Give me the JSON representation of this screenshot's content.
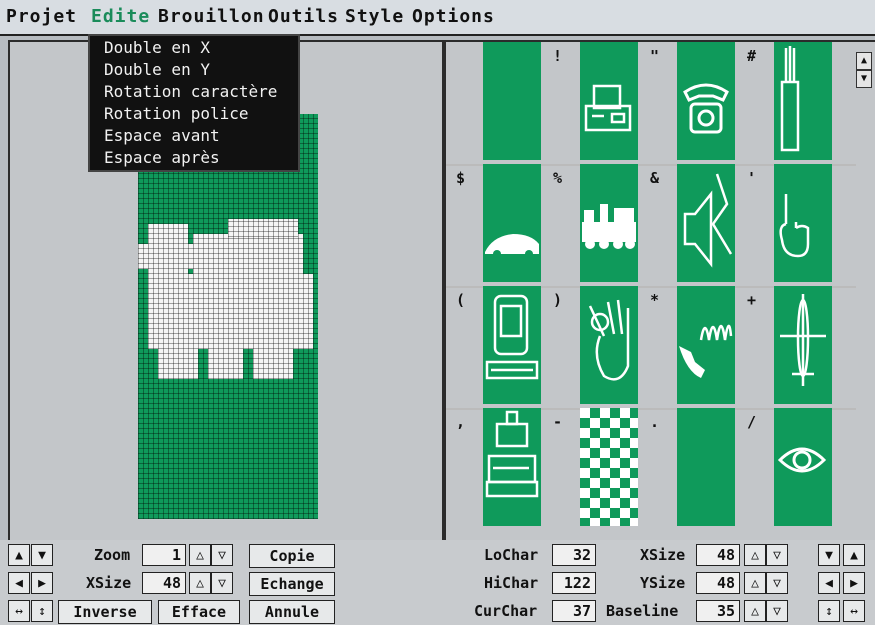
{
  "menubar": {
    "items": [
      "Projet",
      "Edite",
      "Brouillon",
      "Outils",
      "Style",
      "Options"
    ],
    "active_index": 1
  },
  "edit_menu": {
    "items": [
      "Double en X",
      "Double en Y",
      "Rotation caractère",
      "Rotation police",
      "Espace avant",
      "Espace après"
    ]
  },
  "glyph_panel": {
    "cells": [
      {
        "char": "",
        "icon": "blank-icon"
      },
      {
        "char": "!",
        "icon": "printer-icon"
      },
      {
        "char": "\"",
        "icon": "telephone-icon"
      },
      {
        "char": "#",
        "icon": "brush-icon"
      },
      {
        "char": "$",
        "icon": "car-icon"
      },
      {
        "char": "%",
        "icon": "train-icon"
      },
      {
        "char": "&",
        "icon": "speaker-icon"
      },
      {
        "char": "'",
        "icon": "hand-pointing-icon"
      },
      {
        "char": "(",
        "icon": "computer-icon"
      },
      {
        "char": ")",
        "icon": "hand-ok-icon"
      },
      {
        "char": "*",
        "icon": "phone-ringing-icon"
      },
      {
        "char": "+",
        "icon": "airplane-icon"
      },
      {
        "char": ",",
        "icon": "copier-icon"
      },
      {
        "char": "-",
        "icon": "checkerboard-icon"
      },
      {
        "char": ".",
        "icon": "blank-icon"
      },
      {
        "char": "/",
        "icon": "eye-icon"
      }
    ]
  },
  "controls": {
    "zoom_label": "Zoom",
    "zoom_value": "1",
    "xsize_label_left": "XSize",
    "xsize_value_left": "48",
    "copie": "Copie",
    "echange": "Echange",
    "inverse": "Inverse",
    "efface": "Efface",
    "annule": "Annule",
    "lochar_label": "LoChar",
    "lochar_value": "32",
    "hichar_label": "HiChar",
    "hichar_value": "122",
    "curchar_label": "CurChar",
    "curchar_value": "37",
    "xsize_label_right": "XSize",
    "xsize_value_right": "48",
    "ysize_label": "YSize",
    "ysize_value": "48",
    "baseline_label": "Baseline",
    "baseline_value": "35"
  },
  "colors": {
    "accent_green": "#0f9a5b",
    "menu_active": "#1a8b5a"
  }
}
